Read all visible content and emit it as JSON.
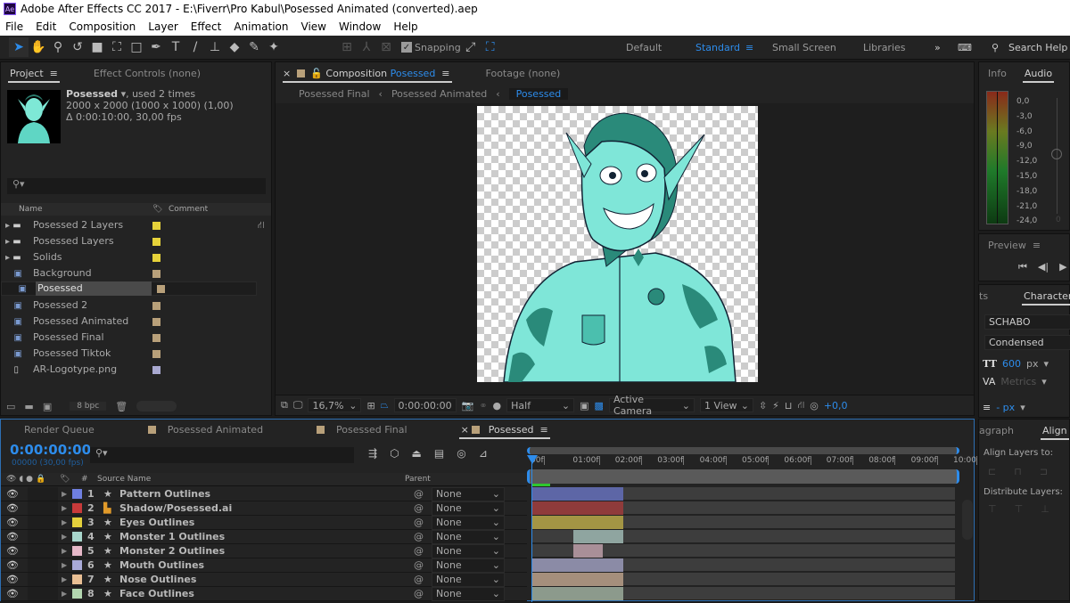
{
  "window": {
    "title": "Adobe After Effects CC 2017 - E:\\Fiverr\\Pro Kabul\\Posessed Animated (converted).aep",
    "app_icon": "Ae"
  },
  "menu": [
    "File",
    "Edit",
    "Composition",
    "Layer",
    "Effect",
    "Animation",
    "View",
    "Window",
    "Help"
  ],
  "toolbar": {
    "snapping": "Snapping",
    "workspaces": [
      "Default",
      "Standard",
      "Small Screen",
      "Libraries"
    ],
    "active_workspace": "Standard",
    "search_help": "Search Help"
  },
  "project": {
    "tabs": [
      "Project",
      "Effect Controls (none)"
    ],
    "selected_name": "Posessed",
    "used": ", used 2 times",
    "dims": "2000 x 2000  (1000 x 1000) (1,00)",
    "duration": "Δ 0:00:10:00, 30,00 fps",
    "col_name": "Name",
    "col_comment": "Comment",
    "bpc": "8 bpc",
    "items": [
      {
        "name": "Posessed 2 Layers",
        "type": "folder",
        "color": "#e6d23a"
      },
      {
        "name": "Posessed Layers",
        "type": "folder",
        "color": "#e6d23a"
      },
      {
        "name": "Solids",
        "type": "folder",
        "color": "#e6d23a"
      },
      {
        "name": "Background",
        "type": "comp",
        "color": "#b8a07a"
      },
      {
        "name": "Posessed",
        "type": "comp",
        "color": "#b8a07a",
        "selected": true
      },
      {
        "name": "Posessed 2",
        "type": "comp",
        "color": "#b8a07a"
      },
      {
        "name": "Posessed Animated",
        "type": "comp",
        "color": "#b8a07a"
      },
      {
        "name": "Posessed Final",
        "type": "comp",
        "color": "#b8a07a"
      },
      {
        "name": "Posessed Tiktok",
        "type": "comp",
        "color": "#b8a07a"
      },
      {
        "name": "AR-Logotype.png",
        "type": "image",
        "color": "#a9a9d0"
      }
    ]
  },
  "composition": {
    "tab_prefix": "Composition",
    "tab_name": "Posessed",
    "footage": "Footage (none)",
    "breadcrumbs": [
      "Posessed Final",
      "Posessed Animated",
      "Posessed"
    ],
    "zoom": "16,7%",
    "timecode": "0:00:00:00",
    "resolution": "Half",
    "camera": "Active Camera",
    "views": "1 View",
    "exposure": "+0,0"
  },
  "info": {
    "tabs": [
      "Info",
      "Audio"
    ],
    "levels": [
      "0,0",
      "-3,0",
      "-6,0",
      "-9,0",
      "-12,0",
      "-15,0",
      "-18,0",
      "-21,0",
      "-24,0"
    ],
    "slider_label": "0"
  },
  "preview": {
    "title": "Preview"
  },
  "character": {
    "tabs": [
      "ts",
      "Character"
    ],
    "font": "SCHABO",
    "style": "Condensed",
    "size": "600",
    "size_unit": "px",
    "kerning": "Metrics",
    "leading": "- px"
  },
  "align": {
    "tabs": [
      "agraph",
      "Align"
    ],
    "align_to": "Align Layers to:",
    "distribute": "Distribute Layers:"
  },
  "timeline": {
    "tabs": [
      "Render Queue",
      "Posessed Animated",
      "Posessed Final",
      "Posessed"
    ],
    "timecode": "0:00:00:00",
    "frames": "00000 (30,00 fps)",
    "col_hash": "#",
    "col_source": "Source Name",
    "col_parent": "Parent",
    "ruler": [
      "00f",
      "01:00f",
      "02:00f",
      "03:00f",
      "04:00f",
      "05:00f",
      "06:00f",
      "07:00f",
      "08:00f",
      "09:00f",
      "10:00"
    ],
    "duration_s": 10,
    "layers": [
      {
        "num": "1",
        "name": "Pattern Outlines",
        "color": "#6f7fe0",
        "parent": "None",
        "in": 0,
        "out": 2.15,
        "bar": "#5d66a6"
      },
      {
        "num": "2",
        "name": "Shadow/Posessed.ai",
        "color": "#c83a3a",
        "parent": "None",
        "in": 0,
        "out": 2.15,
        "bar": "#8f3b3b",
        "ai": true
      },
      {
        "num": "3",
        "name": "Eyes Outlines",
        "color": "#e3d03c",
        "parent": "None",
        "in": 0,
        "out": 2.15,
        "bar": "#a39544"
      },
      {
        "num": "4",
        "name": "Monster 1 Outlines",
        "color": "#a8d6cc",
        "parent": "None",
        "in": 0.97,
        "out": 2.15,
        "bar": "#8fa5a0"
      },
      {
        "num": "5",
        "name": "Monster 2 Outlines",
        "color": "#e6b8c8",
        "parent": "None",
        "in": 0.97,
        "out": 1.67,
        "bar": "#a98f98"
      },
      {
        "num": "6",
        "name": "Mouth Outlines",
        "color": "#a9aad8",
        "parent": "None",
        "in": 0,
        "out": 2.15,
        "bar": "#8b8ba6"
      },
      {
        "num": "7",
        "name": "Nose Outlines",
        "color": "#e9bf94",
        "parent": "None",
        "in": 0,
        "out": 2.15,
        "bar": "#a58f7c"
      },
      {
        "num": "8",
        "name": "Face Outlines",
        "color": "#b3d6b0",
        "parent": "None",
        "in": 0,
        "out": 2.15,
        "bar": "#8c9a8c"
      }
    ]
  }
}
